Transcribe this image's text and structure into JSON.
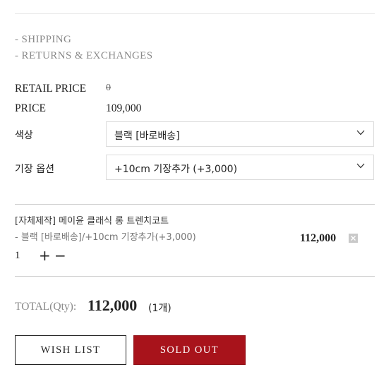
{
  "info_links": {
    "shipping": "- SHIPPING",
    "returns": "- RETURNS & EXCHANGES"
  },
  "pricing": {
    "retail_label": "RETAIL PRICE",
    "retail_value": "0",
    "price_label": "PRICE",
    "price_value": "109,000"
  },
  "options": {
    "color_label": "색상",
    "color_value": "블랙 [바로배송]",
    "length_label": "기장 옵션",
    "length_value": "+10cm 기장추가 (+3,000)",
    "chevron_icon": "chevron-down-icon"
  },
  "cart_item": {
    "name": "[자체제작] 메이윤 클래식 롱 트렌치코트",
    "option": "- 블랙 [바로배송]/+10cm 기장추가(+3,000)",
    "price": "112,000",
    "quantity": "1",
    "plus": "+",
    "minus": "−",
    "remove_icon": "close-icon"
  },
  "total": {
    "label": "TOTAL(Qty):",
    "amount": "112,000",
    "count": "(1개)"
  },
  "buttons": {
    "wishlist": "WISH LIST",
    "soldout": "SOLD OUT"
  },
  "colors": {
    "accent": "#a8131b",
    "muted_text": "#8a8a8a"
  }
}
